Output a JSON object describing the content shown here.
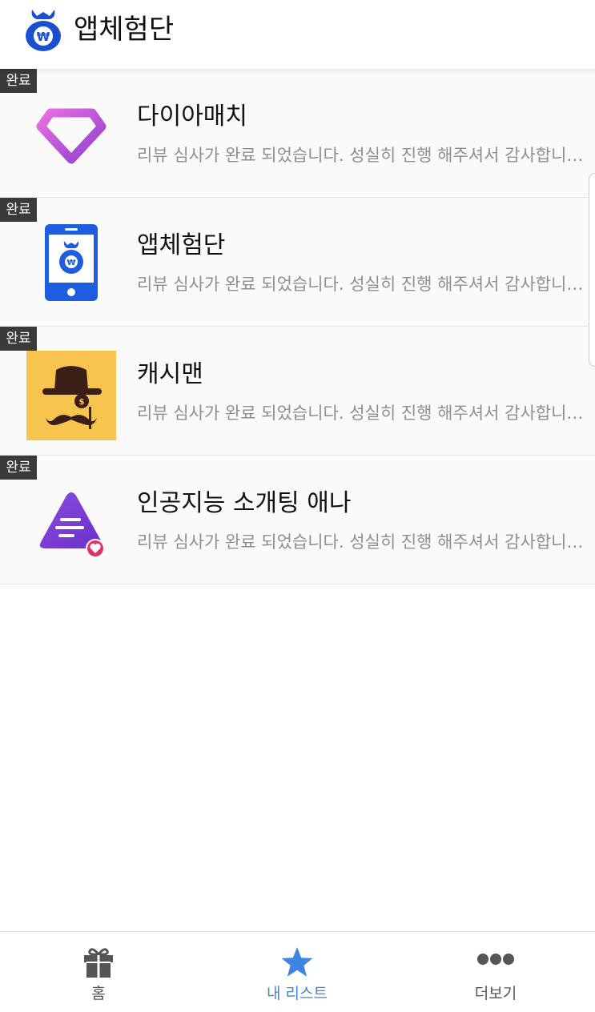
{
  "header": {
    "title": "앱체험단",
    "logo_icon": "money-bag-won-icon"
  },
  "items": [
    {
      "badge": "완료",
      "name": "다이아매치",
      "desc": "리뷰 심사가 완료 되었습니다.  성실히 진행 해주셔서 감사합니다.",
      "icon": "diamond-heart-icon"
    },
    {
      "badge": "완료",
      "name": "앱체험단",
      "desc": "리뷰 심사가 완료 되었습니다.  성실히 진행 해주셔서 감사합니다.",
      "icon": "phone-moneybag-icon"
    },
    {
      "badge": "완료",
      "name": "캐시맨",
      "desc": "리뷰 심사가 완료 되었습니다.  성실히 진행 해주셔서 감사합니다.",
      "icon": "cashman-icon"
    },
    {
      "badge": "완료",
      "name": "인공지능 소개팅 애나",
      "desc": "리뷰 심사가 완료 되었습니다.  성실히 진행 해주셔서 감사합니다.",
      "icon": "chat-heart-icon"
    }
  ],
  "tabbar": {
    "home_label": "홈",
    "mylist_label": "내 리스트",
    "more_label": "더보기",
    "active_color": "#3d85e0",
    "inactive_color": "#555555"
  }
}
